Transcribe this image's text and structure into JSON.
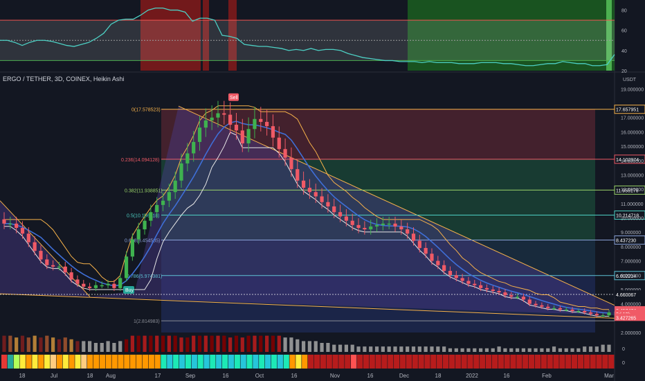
{
  "header": {
    "title": "ERGO / TETHER, 3D, COINEX, Heikin Ashi",
    "currency": "USDT"
  },
  "colors": {
    "background": "#131722",
    "bull": "#26a69a",
    "bull_candle": "#3fb24f",
    "bear_candle": "#f05a66",
    "rsi_line": "#4dd0c4",
    "envelope": "#f7b24a",
    "ma_blue": "#3f6fd8",
    "channel_white": "#ffffff",
    "fib_fill_red": "#6b2a36",
    "fib_fill_green": "#1e5a40",
    "fib_fill_blue": "#1f2c59",
    "triangle_fill": "#4a3a8a"
  },
  "chart_data": [
    {
      "type": "line",
      "name": "rsi_panel",
      "ylim": [
        20,
        90
      ],
      "y_ticks": [
        "80",
        "60",
        "40",
        "20"
      ],
      "bands": [
        70,
        50,
        30
      ],
      "y": [
        50,
        50,
        48,
        45,
        48,
        50,
        50,
        49,
        47,
        45,
        44,
        46,
        48,
        52,
        57,
        66,
        70,
        71,
        71,
        75,
        80,
        82,
        82,
        80,
        80,
        78,
        69,
        72,
        72,
        70,
        55,
        54,
        52,
        46,
        45,
        44,
        44,
        43,
        42,
        40,
        41,
        40,
        42,
        40,
        41,
        41,
        40,
        37,
        35,
        33,
        32,
        31,
        30,
        30,
        29,
        29,
        29,
        28,
        29,
        28,
        28,
        28,
        27,
        27,
        27,
        28,
        28,
        28,
        27,
        27,
        26,
        25,
        25,
        26,
        27,
        27,
        29,
        28,
        27,
        27,
        25,
        25,
        26,
        36
      ],
      "overbought_zones_x_days": [
        [
          95,
          128
        ],
        [
          144,
          150
        ],
        [
          160,
          166
        ]
      ],
      "oversold_zone_x_days": [
        [
          283,
          430
        ]
      ]
    },
    {
      "type": "bar",
      "name": "price_panel",
      "x_tick_labels": [
        "18",
        "Jul",
        "18",
        "Aug",
        "17",
        "Sep",
        "16",
        "Oct",
        "16",
        "Nov",
        "16",
        "Dec",
        "18",
        "2022",
        "16",
        "Feb",
        "Mar"
      ],
      "y_tick_labels": [
        "19.000000",
        "17.000000",
        "16.000000",
        "15.000000",
        "14.000000",
        "13.000000",
        "12.000000",
        "11.000000",
        "10.000000",
        "9.000000",
        "8.000000",
        "7.000000",
        "6.000000",
        "5.000000",
        "4.000000",
        "3.000000",
        "2.000000"
      ],
      "fib_levels": [
        {
          "label": "0(17.578523)",
          "value": 17.578523,
          "price_tag": "17.657951",
          "color": "#f7b24a"
        },
        {
          "label": "0.236(14.094128)",
          "value": 14.094128,
          "price_tag": "14.102974",
          "color": "#f05a66"
        },
        {
          "label": "0.382(11.938851)",
          "value": 11.938851,
          "price_tag": "11.955176",
          "color": "#9bd46a"
        },
        {
          "label": "0.5(10.196718)",
          "value": 10.196718,
          "price_tag": "10.214718",
          "color": "#4dd0c4"
        },
        {
          "label": "0.618(8.454585)",
          "value": 8.454585,
          "price_tag": "8.437230",
          "color": "#8aa2d8"
        },
        {
          "label": "0.786(5.974381)",
          "value": 5.974381,
          "price_tag": "6.002214",
          "color": "#5ec2d6"
        },
        {
          "label": "1(2.814983)",
          "value": 2.814983,
          "price_tag": "3.427265",
          "color": "#8a8d96"
        }
      ],
      "price_tags": [
        {
          "text": "4.660067",
          "color": "#ffffff",
          "bg": "#131722"
        },
        {
          "text": "3.457474",
          "color": "#ffffff",
          "bg": "#f05a66"
        },
        {
          "text": "3d 12h",
          "color": "#ffffff",
          "bg": "#f05a66"
        },
        {
          "text": "3.427265",
          "color": "#ffffff",
          "bg": "#f05a66"
        }
      ],
      "signals": [
        {
          "label": "Buy",
          "bg": "#26a69a"
        },
        {
          "label": "Sell",
          "bg": "#f05a66"
        }
      ],
      "candles_close": [
        9.6,
        9.6,
        9.3,
        8.9,
        8.3,
        7.7,
        7.1,
        6.7,
        6.6,
        6.6,
        6.2,
        5.7,
        5.4,
        5.2,
        5.1,
        5.3,
        5.3,
        5.4,
        5.1,
        5.8,
        7.3,
        8.5,
        9.2,
        9.8,
        10.4,
        10.9,
        11.2,
        11.8,
        12.6,
        13.8,
        14.5,
        15.3,
        16.3,
        16.8,
        17.0,
        17.3,
        17.2,
        16.5,
        16.1,
        15.2,
        16.2,
        16.9,
        16.7,
        16.4,
        15.6,
        14.8,
        14.2,
        13.4,
        12.6,
        12.1,
        11.8,
        11.5,
        11.1,
        10.8,
        10.4,
        10.1,
        9.8,
        9.5,
        9.3,
        9.2,
        9.4,
        9.5,
        9.6,
        9.6,
        9.4,
        9.2,
        8.9,
        8.4,
        7.9,
        7.5,
        7.0,
        6.7,
        6.3,
        6.0,
        5.8,
        5.6,
        5.4,
        5.3,
        5.1,
        5.0,
        4.9,
        4.8,
        4.6,
        4.5,
        4.5,
        4.3,
        4.0,
        3.9,
        3.8,
        3.7,
        3.7,
        3.6,
        3.6,
        3.5,
        3.5,
        3.4,
        3.3,
        3.2,
        3.2,
        3.4
      ],
      "volume": [
        0.9,
        0.9,
        0.8,
        0.9,
        0.8,
        0.9,
        0.8,
        0.9,
        0.8,
        0.7,
        0.8,
        0.7,
        0.6,
        0.6,
        0.6,
        0.5,
        0.5,
        0.6,
        0.5,
        0.6,
        0.7,
        0.9,
        0.9,
        0.9,
        0.9,
        0.9,
        0.9,
        0.9,
        0.9,
        0.8,
        0.8,
        0.9,
        0.9,
        0.9,
        0.9,
        0.9,
        0.9,
        0.8,
        0.9,
        0.8,
        0.9,
        0.9,
        0.9,
        0.9,
        0.9,
        0.9,
        0.8,
        0.8,
        0.7,
        0.6,
        0.6,
        0.6,
        0.5,
        0.5,
        0.4,
        0.4,
        0.4,
        0.4,
        0.3,
        0.3,
        0.3,
        0.3,
        0.3,
        0.3,
        0.3,
        0.3,
        0.3,
        0.3,
        0.3,
        0.3,
        0.3,
        0.3,
        0.3,
        0.2,
        0.2,
        0.2,
        0.2,
        0.2,
        0.2,
        0.2,
        0.2,
        0.3,
        0.2,
        0.2,
        0.2,
        0.2,
        0.2,
        0.2,
        0.2,
        0.2,
        0.3,
        0.2,
        0.2,
        0.2,
        0.2,
        0.3,
        0.3,
        0.3,
        0.4,
        0.4
      ]
    }
  ]
}
